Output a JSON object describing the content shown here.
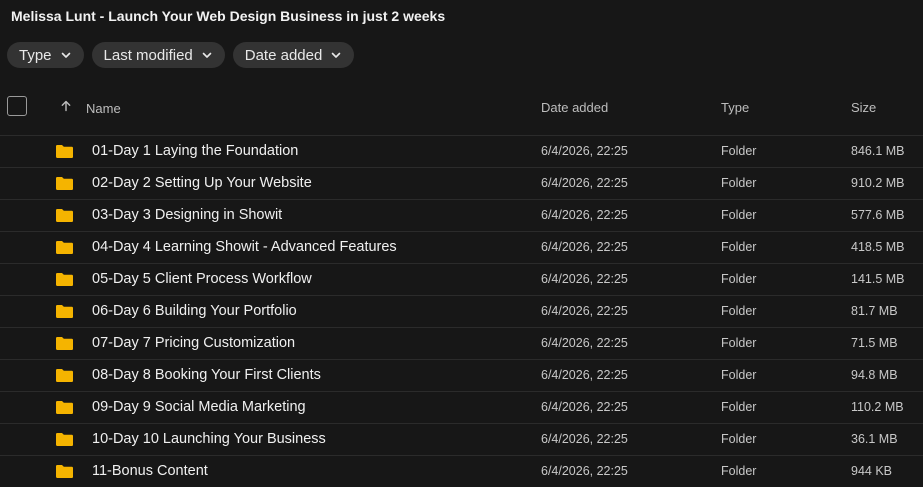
{
  "title": "Melissa Lunt - Launch Your Web Design Business in just 2 weeks",
  "filters": [
    {
      "label": "Type"
    },
    {
      "label": "Last modified"
    },
    {
      "label": "Date added"
    }
  ],
  "columns": {
    "name": "Name",
    "date_added": "Date added",
    "type": "Type",
    "size": "Size"
  },
  "colors": {
    "background": "#171717",
    "folder": "#f5b400",
    "chip": "#333333"
  },
  "rows": [
    {
      "name": "01-Day 1 Laying the Foundation",
      "date": "6/4/2026, 22:25",
      "type": "Folder",
      "size": "846.1 MB",
      "icon": "folder-icon"
    },
    {
      "name": "02-Day 2 Setting Up Your Website",
      "date": "6/4/2026, 22:25",
      "type": "Folder",
      "size": "910.2 MB",
      "icon": "folder-icon"
    },
    {
      "name": "03-Day 3 Designing in Showit",
      "date": "6/4/2026, 22:25",
      "type": "Folder",
      "size": "577.6 MB",
      "icon": "folder-icon"
    },
    {
      "name": "04-Day 4 Learning Showit - Advanced Features",
      "date": "6/4/2026, 22:25",
      "type": "Folder",
      "size": "418.5 MB",
      "icon": "folder-icon"
    },
    {
      "name": "05-Day 5 Client Process Workflow",
      "date": "6/4/2026, 22:25",
      "type": "Folder",
      "size": "141.5 MB",
      "icon": "folder-icon"
    },
    {
      "name": "06-Day 6 Building Your Portfolio",
      "date": "6/4/2026, 22:25",
      "type": "Folder",
      "size": "81.7 MB",
      "icon": "folder-icon"
    },
    {
      "name": "07-Day 7 Pricing Customization",
      "date": "6/4/2026, 22:25",
      "type": "Folder",
      "size": "71.5 MB",
      "icon": "folder-icon"
    },
    {
      "name": "08-Day 8 Booking Your First Clients",
      "date": "6/4/2026, 22:25",
      "type": "Folder",
      "size": "94.8 MB",
      "icon": "folder-icon"
    },
    {
      "name": "09-Day 9 Social Media Marketing",
      "date": "6/4/2026, 22:25",
      "type": "Folder",
      "size": "110.2 MB",
      "icon": "folder-icon"
    },
    {
      "name": "10-Day 10 Launching Your Business",
      "date": "6/4/2026, 22:25",
      "type": "Folder",
      "size": "36.1 MB",
      "icon": "folder-icon"
    },
    {
      "name": "11-Bonus Content",
      "date": "6/4/2026, 22:25",
      "type": "Folder",
      "size": "944 KB",
      "icon": "folder-icon"
    }
  ]
}
